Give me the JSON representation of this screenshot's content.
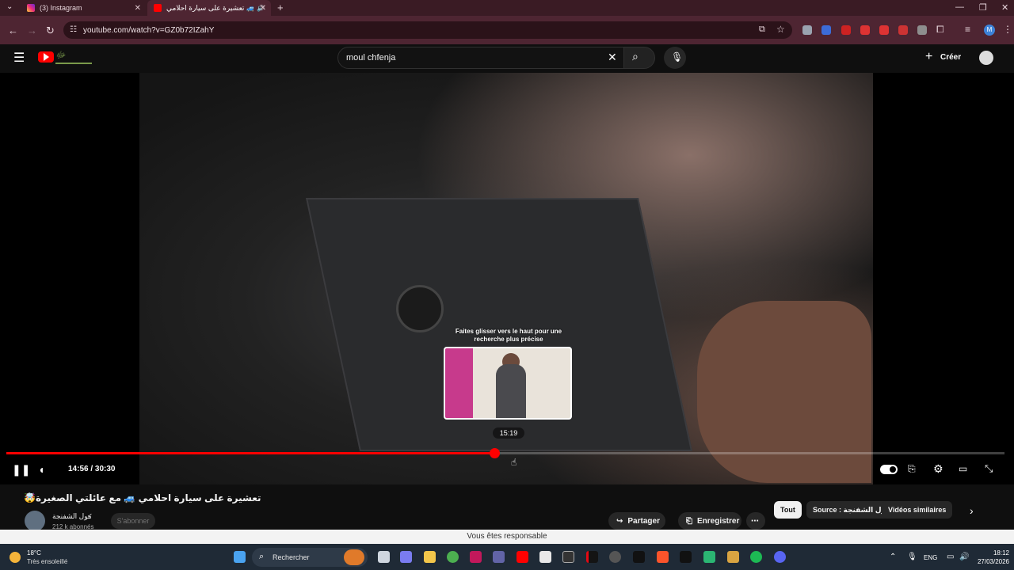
{
  "browser": {
    "tabs": [
      {
        "label": "(3) Instagram",
        "favicon_color": "#d62976",
        "active": false
      },
      {
        "label": "تعشيرة على سيارة احلامي 🚙",
        "favicon_color": "#ff0000",
        "active": true
      }
    ],
    "new_tab_icon": "plus-icon",
    "url": "youtube.com/watch?v=GZ0b72IZahY"
  },
  "youtube": {
    "search_query": "moul chfenja",
    "create_label": "Créer",
    "brand_color": "#ff0000"
  },
  "player": {
    "hint_text": "Faites glisser vers le haut pour une recherche plus précise",
    "preview_time": "15:19",
    "current_time": "14:56",
    "duration": "30:30",
    "time_display": "14:56 / 30:30",
    "progress_fraction": 0.489,
    "hover_fraction": 0.489,
    "progress_color": "#ff0000"
  },
  "video": {
    "title": "🤯تعشيرة على سيارة احلامي 🚙 مع عائلتي الصغيرة",
    "channel_name": "مول الشفنجة",
    "subscribers": "212 k abonnés",
    "subscribe_label": "S'abonner",
    "share_label": "Partager",
    "save_label": "Enregistrer"
  },
  "chips": [
    {
      "label": "Tout",
      "selected": true
    },
    {
      "label": "Source : مول الشفنجة",
      "selected": false
    },
    {
      "label": "Vidéos similaires",
      "selected": false
    }
  ],
  "notification": "Vous êtes responsable",
  "taskbar": {
    "temperature": "18°C",
    "weather": "Très ensoleillé",
    "search_label": "Rechercher",
    "language": "ENG",
    "time": "18:12",
    "date": "27/03/2026"
  }
}
